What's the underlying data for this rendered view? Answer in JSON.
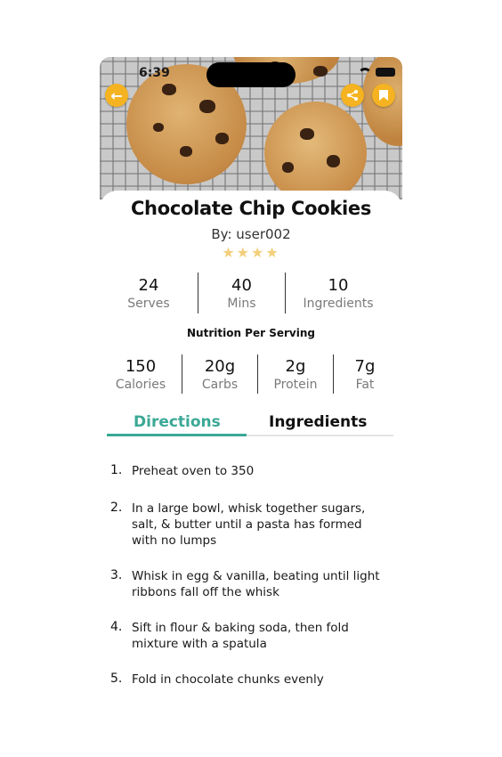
{
  "status_bar": {
    "time": "6:39"
  },
  "recipe": {
    "title": "Chocolate Chip Cookies",
    "author": "By: user002",
    "rating_stars": 4,
    "stars_display": "★★★★"
  },
  "stats": [
    {
      "value": "24",
      "label": "Serves"
    },
    {
      "value": "40",
      "label": "Mins"
    },
    {
      "value": "10",
      "label": "Ingredients"
    }
  ],
  "nutrition": {
    "heading": "Nutrition Per Serving",
    "items": [
      {
        "value": "150",
        "label": "Calories"
      },
      {
        "value": "20g",
        "label": "Carbs"
      },
      {
        "value": "2g",
        "label": "Protein"
      },
      {
        "value": "7g",
        "label": "Fat"
      }
    ]
  },
  "tabs": [
    {
      "label": "Directions",
      "active": true
    },
    {
      "label": "Ingredients",
      "active": false
    }
  ],
  "directions": [
    {
      "num": "1.",
      "text": "Preheat oven to 350"
    },
    {
      "num": "2.",
      "text": "In a large bowl, whisk together sugars, salt, & butter until a pasta has formed with no lumps"
    },
    {
      "num": "3.",
      "text": "Whisk in egg & vanilla, beating until light ribbons fall off the whisk"
    },
    {
      "num": "4.",
      "text": "Sift in flour & baking soda, then fold mixture with a spatula"
    },
    {
      "num": "5.",
      "text": "Fold in chocolate chunks evenly"
    }
  ],
  "icons": {
    "back": "back-arrow-icon",
    "share": "share-icon",
    "bookmark": "bookmark-icon"
  },
  "colors": {
    "accent": "#3aa896",
    "button": "#f5b321",
    "stars": "#f3cf7a"
  }
}
